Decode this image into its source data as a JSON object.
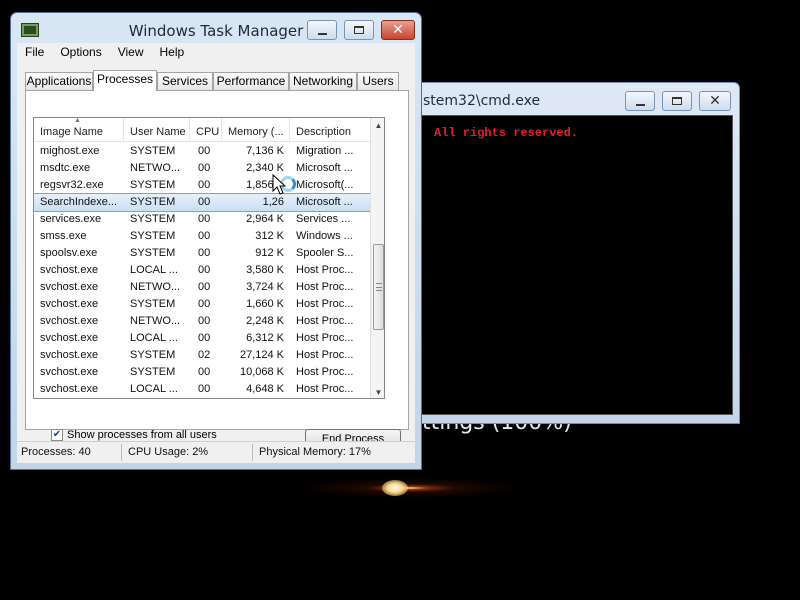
{
  "background": {
    "settings_text": "ttings (100%)"
  },
  "cmd_window": {
    "title": "stem32\\cmd.exe",
    "console_line": "All rights reserved.",
    "console_text_color": "#e0202a"
  },
  "task_manager": {
    "title": "Windows Task Manager",
    "menu": [
      "File",
      "Options",
      "View",
      "Help"
    ],
    "tabs": [
      "Applications",
      "Processes",
      "Services",
      "Performance",
      "Networking",
      "Users"
    ],
    "active_tab": "Processes",
    "columns": {
      "name": "Image Name",
      "user": "User Name",
      "cpu": "CPU",
      "memory": "Memory (...",
      "description": "Description"
    },
    "rows": [
      {
        "name": "mighost.exe",
        "user": "SYSTEM",
        "cpu": "00",
        "memory": "7,136 K",
        "description": "Migration ..."
      },
      {
        "name": "msdtc.exe",
        "user": "NETWO...",
        "cpu": "00",
        "memory": "2,340 K",
        "description": "Microsoft ..."
      },
      {
        "name": "regsvr32.exe",
        "user": "SYSTEM",
        "cpu": "00",
        "memory": "1,856 K",
        "description": "Microsoft(..."
      },
      {
        "name": "SearchIndexe...",
        "user": "SYSTEM",
        "cpu": "00",
        "memory": "1,26",
        "description": "Microsoft ...",
        "selected": true
      },
      {
        "name": "services.exe",
        "user": "SYSTEM",
        "cpu": "00",
        "memory": "2,964 K",
        "description": "Services ..."
      },
      {
        "name": "smss.exe",
        "user": "SYSTEM",
        "cpu": "00",
        "memory": "312 K",
        "description": "Windows ..."
      },
      {
        "name": "spoolsv.exe",
        "user": "SYSTEM",
        "cpu": "00",
        "memory": "912 K",
        "description": "Spooler S..."
      },
      {
        "name": "svchost.exe",
        "user": "LOCAL ...",
        "cpu": "00",
        "memory": "3,580 K",
        "description": "Host Proc..."
      },
      {
        "name": "svchost.exe",
        "user": "NETWO...",
        "cpu": "00",
        "memory": "3,724 K",
        "description": "Host Proc..."
      },
      {
        "name": "svchost.exe",
        "user": "SYSTEM",
        "cpu": "00",
        "memory": "1,660 K",
        "description": "Host Proc..."
      },
      {
        "name": "svchost.exe",
        "user": "NETWO...",
        "cpu": "00",
        "memory": "2,248 K",
        "description": "Host Proc..."
      },
      {
        "name": "svchost.exe",
        "user": "LOCAL ...",
        "cpu": "00",
        "memory": "6,312 K",
        "description": "Host Proc..."
      },
      {
        "name": "svchost.exe",
        "user": "SYSTEM",
        "cpu": "02",
        "memory": "27,124 K",
        "description": "Host Proc..."
      },
      {
        "name": "svchost.exe",
        "user": "SYSTEM",
        "cpu": "00",
        "memory": "10,068 K",
        "description": "Host Proc..."
      },
      {
        "name": "svchost.exe",
        "user": "LOCAL ...",
        "cpu": "00",
        "memory": "4,648 K",
        "description": "Host Proc..."
      }
    ],
    "show_all_label": "Show processes from all users",
    "show_all_checked": true,
    "end_process_label": "End Process",
    "status": {
      "processes": "Processes: 40",
      "cpu_usage": "CPU Usage: 2%",
      "physical_memory": "Physical Memory: 17%"
    }
  }
}
